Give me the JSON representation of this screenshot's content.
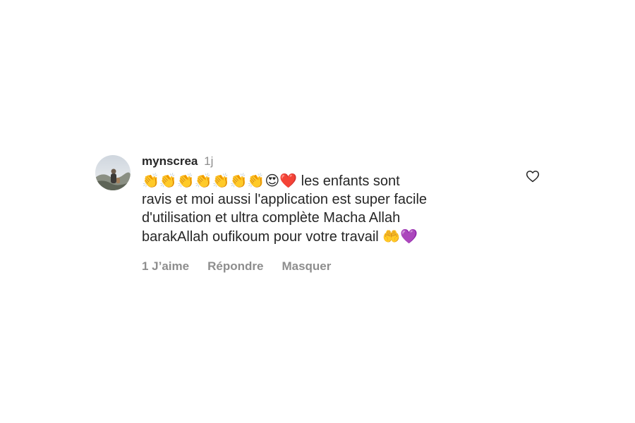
{
  "comment": {
    "username": "mynscrea",
    "timestamp": "1j",
    "emoji_prefix": "👏👏👏👏👏👏👏😍❤️",
    "text_line1": "les enfants sont",
    "text_line2": "ravis et moi aussi l'application est super facile",
    "text_line3": "d'utilisation et ultra complète Macha Allah",
    "text_line4": "barakAllah oufikoum pour votre travail",
    "emoji_suffix": "🤲💜",
    "actions": {
      "likes": "1 J’aime",
      "reply": "Répondre",
      "hide": "Masquer"
    }
  },
  "icons": {
    "avatar": "user-avatar-photo",
    "like": "heart-outline-icon"
  },
  "colors": {
    "text": "#262626",
    "secondary": "#8e8e8e",
    "background": "#ffffff"
  }
}
